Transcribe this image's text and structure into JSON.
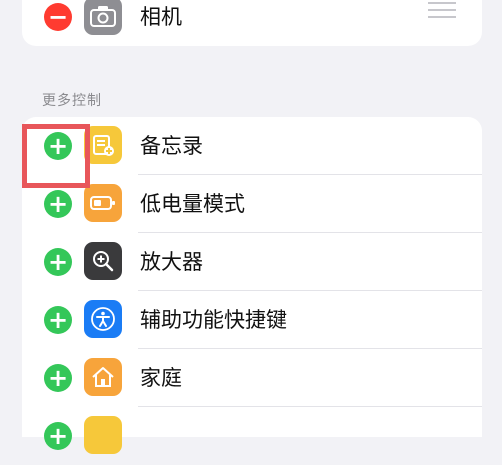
{
  "top_control": {
    "label": "相机",
    "icon": "camera-icon",
    "icon_color": "#8e8e93"
  },
  "more_controls": {
    "header": "更多控制",
    "items": [
      {
        "label": "备忘录",
        "icon": "notes-icon",
        "icon_color": "#f6c83a"
      },
      {
        "label": "低电量模式",
        "icon": "battery-icon",
        "icon_color": "#f7a43b"
      },
      {
        "label": "放大器",
        "icon": "magnifier-icon",
        "icon_color": "#3a3a3c"
      },
      {
        "label": "辅助功能快捷键",
        "icon": "accessibility-icon",
        "icon_color": "#1a7cf5"
      },
      {
        "label": "家庭",
        "icon": "home-icon",
        "icon_color": "#f7a43b"
      }
    ]
  },
  "colors": {
    "add_green": "#34c759",
    "remove_red": "#ff3b30",
    "highlight": "#e8565a",
    "background": "#f2f2f6"
  }
}
